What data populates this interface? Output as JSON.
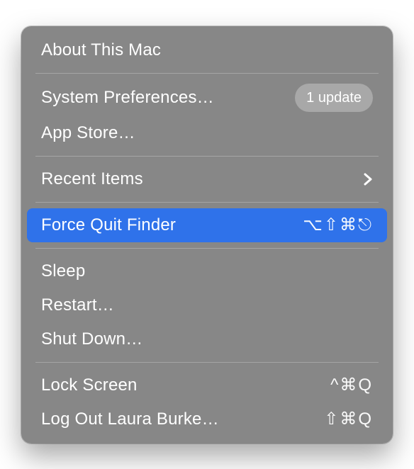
{
  "menu": {
    "about": {
      "label": "About This Mac"
    },
    "systemPreferences": {
      "label": "System Preferences…",
      "badge": "1 update"
    },
    "appStore": {
      "label": "App Store…"
    },
    "recentItems": {
      "label": "Recent Items"
    },
    "forceQuit": {
      "label": "Force Quit Finder",
      "shortcut": "⌥⇧⌘⎋"
    },
    "sleep": {
      "label": "Sleep"
    },
    "restart": {
      "label": "Restart…"
    },
    "shutDown": {
      "label": "Shut Down…"
    },
    "lockScreen": {
      "label": "Lock Screen",
      "shortcut": "^⌘Q"
    },
    "logOut": {
      "label": "Log Out Laura Burke…",
      "shortcut": "⇧⌘Q"
    }
  }
}
